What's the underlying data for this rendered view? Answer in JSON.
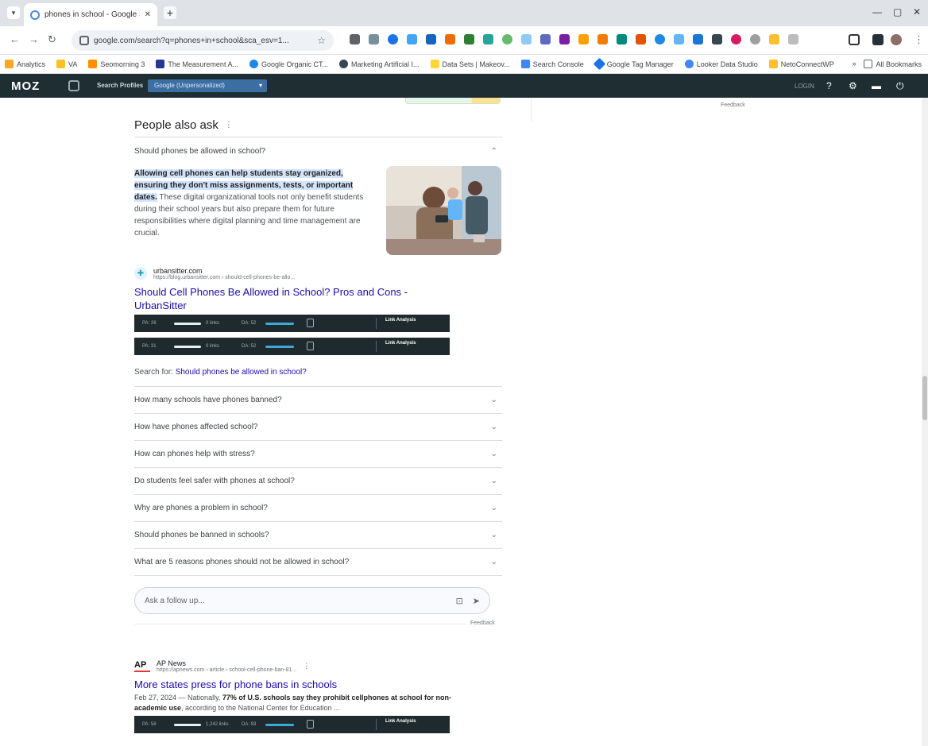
{
  "browser": {
    "tab_title": "phones in school - Google Se...",
    "url": "google.com/search?q=phones+in+school&sca_esv=1...",
    "bookmarks": [
      "Analytics",
      "VA",
      "Seomorning 3",
      "The Measurement A...",
      "Google Organic CT...",
      "Marketing Artificial I...",
      "Data Sets | Makeov...",
      "Search Console",
      "Google Tag Manager",
      "Looker Data Studio",
      "NetoConnectWP"
    ],
    "bookmarks_right": "All Bookmarks"
  },
  "mozbar": {
    "logo": "MOZ",
    "search_profiles_label": "Search Profiles",
    "profile_select": "Google (Unpersonalized)",
    "login": "LOGIN",
    "help": "?"
  },
  "serp": {
    "sidebar_feedback": "Feedback",
    "paa_title": "People also ask",
    "paa_info": "⋮",
    "open_question": "Should phones be allowed in school?",
    "answer_highlight": "Allowing cell phones can help students stay organized, ensuring they don't miss assignments, tests, or important dates.",
    "answer_rest": " These digital organizational tools not only benefit students during their school years but also prepare them for future responsibilities where digital planning and time management are crucial.",
    "source_site": "urbansitter.com",
    "source_url": "https://blog.urbansitter.com › should-cell-phones-be-allo...",
    "result_title": "Should Cell Phones Be Allowed in School? Pros and Cons - UrbanSitter",
    "metrics": [
      {
        "pa": "PA: 26",
        "links": "0 links",
        "da": "DA: 52",
        "link_analysis": "Link Analysis"
      },
      {
        "pa": "PA: 31",
        "links": "0 links",
        "da": "DA: 52",
        "link_analysis": "Link Analysis"
      }
    ],
    "search_for_prefix": "Search for: ",
    "search_for_link": "Should phones be allowed in school?",
    "questions": [
      "How many schools have phones banned?",
      "How have phones affected school?",
      "How can phones help with stress?",
      "Do students feel safer with phones at school?",
      "Why are phones a problem in school?",
      "Should phones be banned in schools?",
      "What are 5 reasons phones should not be allowed in school?"
    ],
    "followup_placeholder": "Ask a follow up...",
    "feedback": "Feedback",
    "result2": {
      "logo": "AP",
      "site": "AP News",
      "url": "https://apnews.com › article › school-cell-phone-ban-81...",
      "title": "More states press for phone bans in schools",
      "date": "Feb 27, 2024 — ",
      "snippet_pre": "Nationally, ",
      "snippet_bold": "77% of U.S. schools say they prohibit cellphones at school for non-academic use",
      "snippet_post": ", according to the National Center for Education ...",
      "metric": {
        "pa": "PA: 58",
        "links": "1,242 links",
        "da": "DA: 93",
        "link_analysis": "Link Analysis"
      }
    }
  }
}
